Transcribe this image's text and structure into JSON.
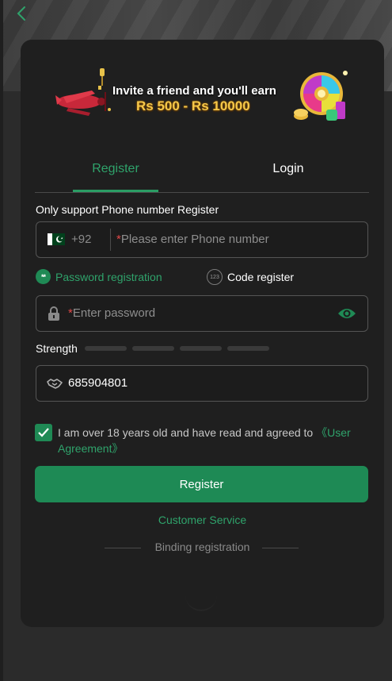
{
  "banner": {
    "line1": "Invite a friend and you'll earn",
    "line2": "Rs 500 - Rs 10000"
  },
  "tabs": [
    {
      "label": "Register",
      "active": true
    },
    {
      "label": "Login",
      "active": false
    }
  ],
  "phone": {
    "section_label": "Only support Phone number Register",
    "country_code": "+92",
    "required_mark": "*",
    "placeholder": "Please enter Phone number"
  },
  "options": {
    "password_label": "Password registration",
    "password_icon_text": "**",
    "code_label": "Code register",
    "code_icon_text": "123"
  },
  "password": {
    "required_mark": "*",
    "placeholder": "Enter password"
  },
  "strength": {
    "label": "Strength"
  },
  "invite": {
    "value": "685904801"
  },
  "agreement": {
    "checked": true,
    "text": "I am over 18 years old and have read and agreed to",
    "link": "《User Agreement》"
  },
  "register_button": "Register",
  "customer_service": "Customer Service",
  "binding_registration": "Binding registration",
  "colors": {
    "accent": "#1e8a55",
    "accent_text": "#2fa36b",
    "card_bg": "#1f1f1f",
    "required": "#e04848"
  }
}
